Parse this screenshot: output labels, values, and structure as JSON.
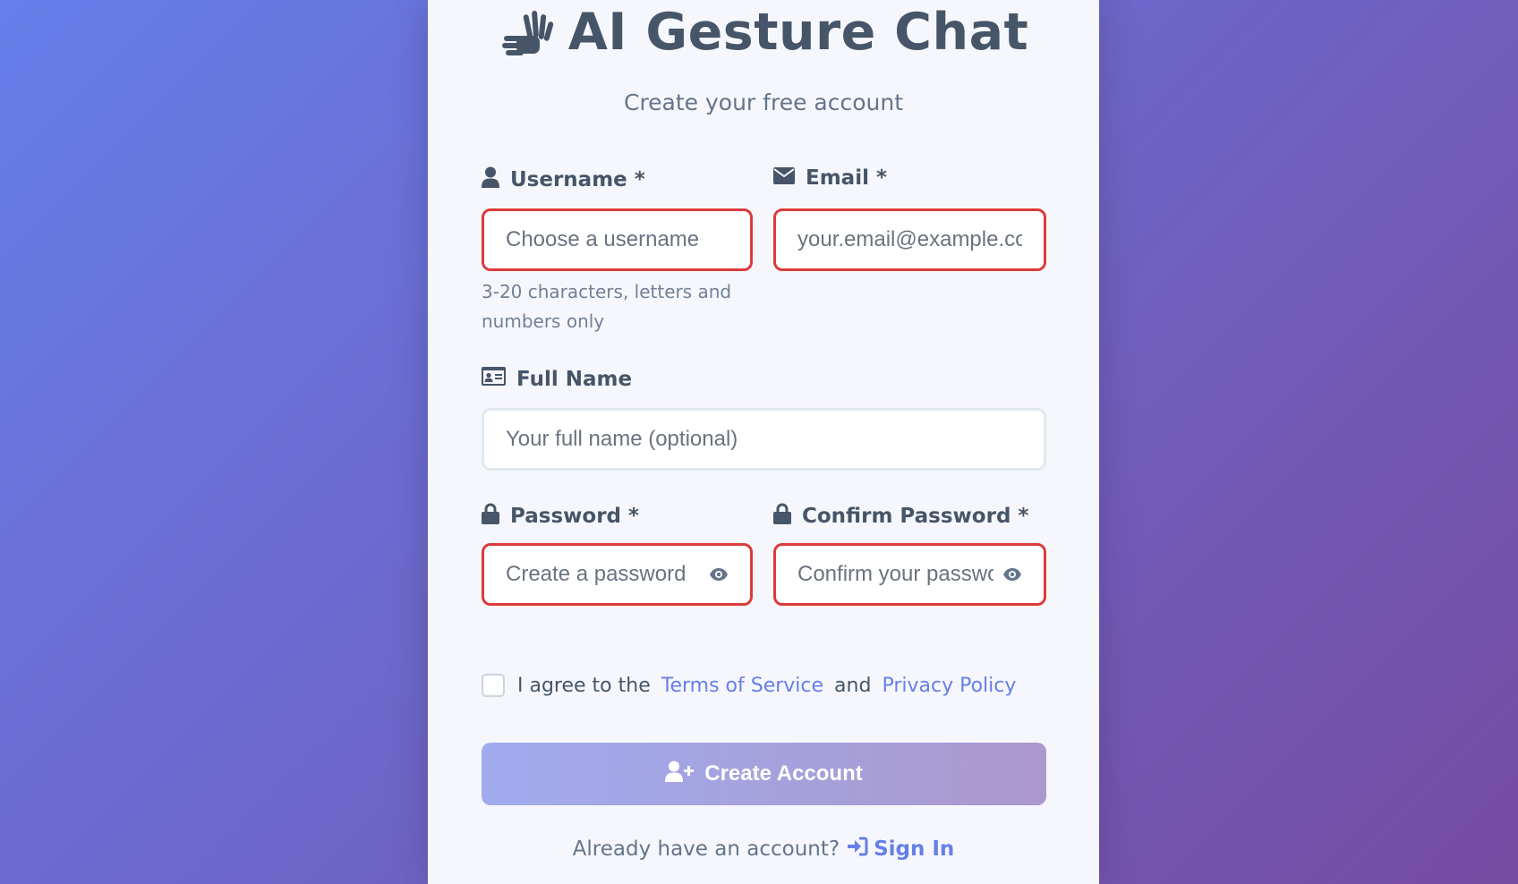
{
  "header": {
    "app_icon": "waving-hands-icon",
    "title": "AI Gesture Chat",
    "subtitle": "Create your free account"
  },
  "form": {
    "username": {
      "icon": "user-icon",
      "label": "Username *",
      "placeholder": "Choose a username",
      "value": "",
      "hint": "3-20 characters, letters and numbers only"
    },
    "email": {
      "icon": "envelope-icon",
      "label": "Email *",
      "placeholder": "your.email@example.com",
      "value": ""
    },
    "full_name": {
      "icon": "id-card-icon",
      "label": "Full Name",
      "placeholder": "Your full name (optional)",
      "value": ""
    },
    "password": {
      "icon": "lock-icon",
      "label": "Password *",
      "placeholder": "Create a password",
      "value": ""
    },
    "confirm_password": {
      "icon": "lock-icon",
      "label": "Confirm Password *",
      "placeholder": "Confirm your password",
      "value": ""
    },
    "terms": {
      "checked": false,
      "prefix": "I agree to the",
      "terms_link": "Terms of Service",
      "conjunction": "and",
      "privacy_link": "Privacy Policy"
    },
    "submit": {
      "icon": "user-plus-icon",
      "label": "Create Account"
    }
  },
  "footer": {
    "prompt": "Already have an account?",
    "signin_icon": "sign-in-icon",
    "signin_label": "Sign In"
  },
  "colors": {
    "background_start": "#667eea",
    "background_end": "#764ba2",
    "error_border": "#dc3b3b",
    "accent": "#667eea",
    "text_dark": "#475569"
  }
}
